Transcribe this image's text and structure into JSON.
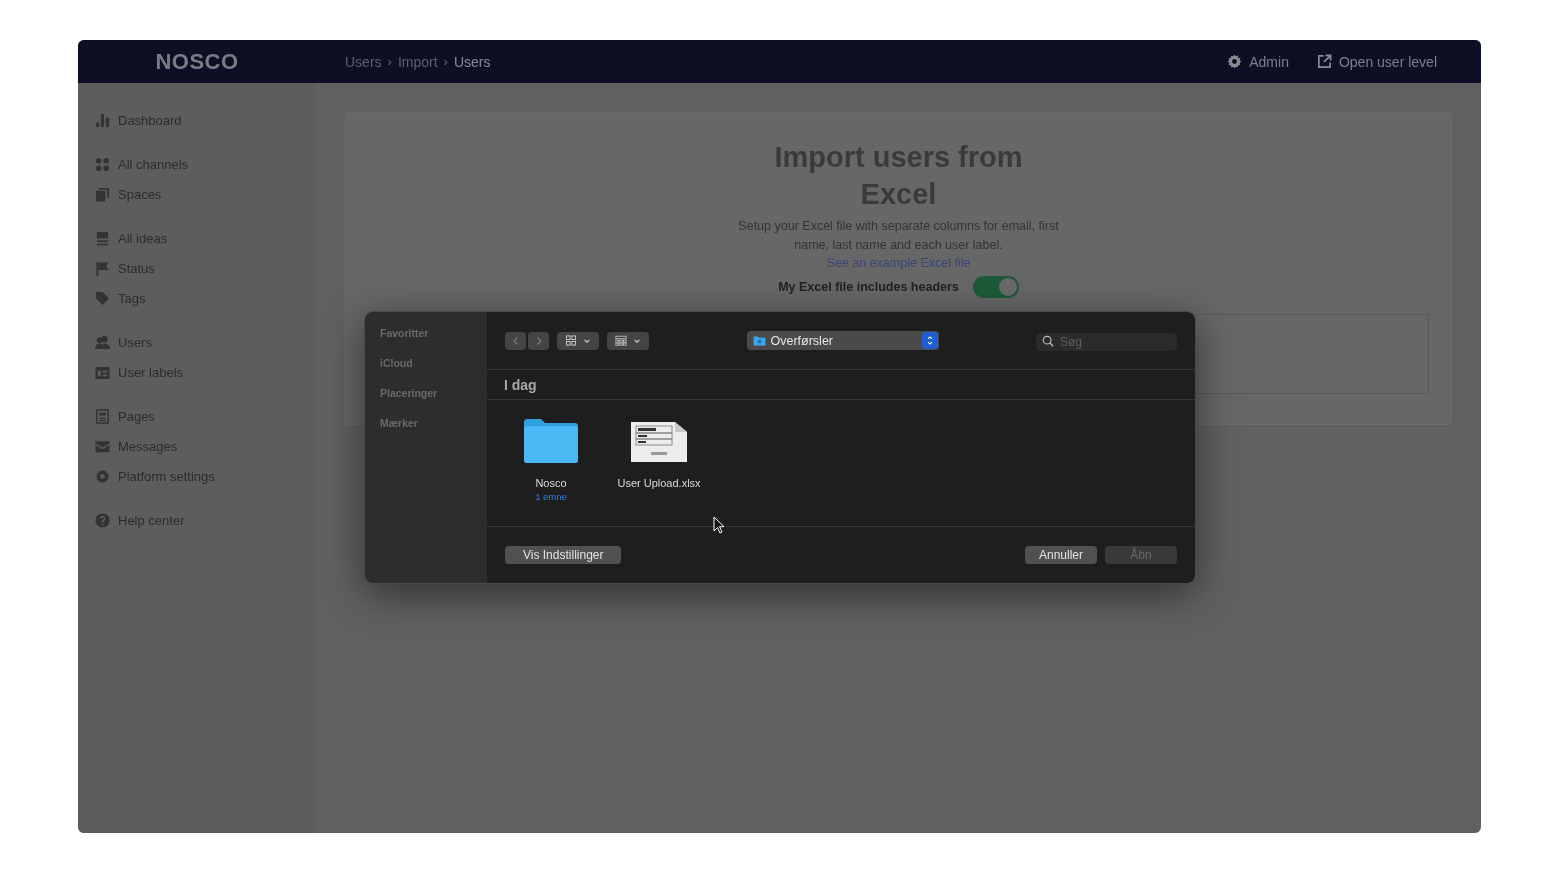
{
  "app_bar": {
    "logo": "NOSCO",
    "breadcrumbs": [
      {
        "label": "Users",
        "separator": "›"
      },
      {
        "label": "Import",
        "separator": "›"
      },
      {
        "label": "Users"
      }
    ],
    "actions": [
      {
        "label": "Admin"
      },
      {
        "label": "Open user level"
      }
    ]
  },
  "sidebar": {
    "groups": [
      {
        "items": [
          {
            "label": "Dashboard"
          }
        ]
      },
      {
        "items": [
          {
            "label": "All channels"
          },
          {
            "label": "Spaces"
          }
        ]
      },
      {
        "items": [
          {
            "label": "All ideas"
          },
          {
            "label": "Status"
          },
          {
            "label": "Tags"
          }
        ]
      },
      {
        "items": [
          {
            "label": "Users"
          },
          {
            "label": "User labels"
          }
        ]
      },
      {
        "items": [
          {
            "label": "Pages"
          },
          {
            "label": "Messages"
          },
          {
            "label": "Platform settings"
          }
        ]
      },
      {
        "items": [
          {
            "label": "Help center"
          }
        ]
      }
    ]
  },
  "import_card": {
    "title": "Import users from Excel",
    "description": "Setup your Excel file with separate columns for email, first name, last name and each user label.",
    "example_link": "See an example Excel file",
    "headers_toggle": {
      "label": "My Excel file includes headers",
      "on": true
    }
  },
  "file_dialog": {
    "sidebar_sections": [
      "Favoritter",
      "iCloud",
      "Placeringer",
      "Mærker"
    ],
    "location": "Overførsler",
    "search": {
      "placeholder": "Søg"
    },
    "section_title": "I dag",
    "files": [
      {
        "kind": "folder",
        "name": "Nosco",
        "detail": "1 emne"
      },
      {
        "kind": "spreadsheet",
        "name": "User Upload.xlsx"
      }
    ],
    "options_button": "Vis Indstillinger",
    "buttons": [
      {
        "label": "Annuller",
        "disabled": false
      },
      {
        "label": "Åbn",
        "disabled": true
      }
    ]
  }
}
